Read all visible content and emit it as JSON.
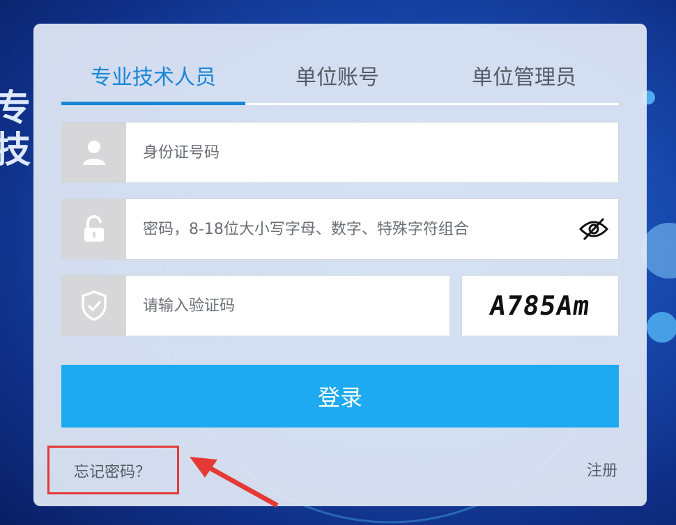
{
  "tabs": [
    {
      "label": "专业技术人员",
      "active": true
    },
    {
      "label": "单位账号",
      "active": false
    },
    {
      "label": "单位管理员",
      "active": false
    }
  ],
  "fields": {
    "id_placeholder": "身份证号码",
    "password_placeholder": "密码，8-18位大小写字母、数字、特殊字符组合",
    "captcha_placeholder": "请输入验证码"
  },
  "captcha": {
    "text": "A785Am"
  },
  "login_button": "登录",
  "forgot_password": "忘记密码？",
  "register": "注册",
  "icons": [
    "user-icon",
    "lock-icon",
    "shield-icon",
    "eye-slash-icon",
    "arrow-annotation-icon"
  ],
  "colors": {
    "accent": "#1a86d6",
    "button": "#1eaaf1",
    "highlight": "#e53935"
  }
}
